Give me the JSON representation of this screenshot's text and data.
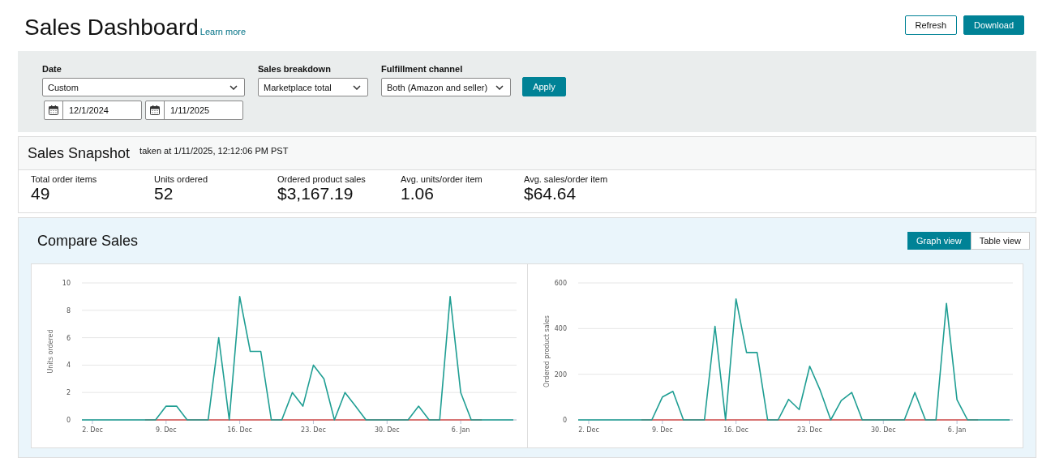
{
  "header": {
    "title": "Sales Dashboard",
    "link": "Learn more",
    "buttons": [
      {
        "label": "Refresh",
        "kind": "secondary"
      },
      {
        "label": "Download",
        "kind": "primary"
      }
    ]
  },
  "filters": {
    "date": {
      "label": "Date",
      "value": "Custom",
      "start": "12/1/2024",
      "end": "1/11/2025"
    },
    "selects": [
      {
        "label": "Sales breakdown",
        "value": "Marketplace total"
      },
      {
        "label": "Fulfillment channel",
        "value": "Both (Amazon and seller)"
      }
    ],
    "apply": "Apply"
  },
  "snapshot": {
    "title": "Sales Snapshot",
    "taken": "taken at 1/11/2025, 12:12:06 PM PST",
    "metrics": [
      {
        "label": "Total order items",
        "value": "49"
      },
      {
        "label": "Units ordered",
        "value": "52"
      },
      {
        "label": "Ordered product sales",
        "value": "$3,167.19"
      },
      {
        "label": "Avg. units/order item",
        "value": "1.06"
      },
      {
        "label": "Avg. sales/order item",
        "value": "$64.64"
      }
    ]
  },
  "compare": {
    "title": "Compare Sales",
    "views": [
      {
        "label": "Graph view",
        "selected": true
      },
      {
        "label": "Table view",
        "selected": false
      }
    ],
    "charts": [
      {
        "chart_data": {
          "type": "line",
          "ylabel": "Units ordered",
          "categories": [
            null,
            "2. Dec",
            null,
            null,
            null,
            null,
            null,
            null,
            "9. Dec",
            null,
            null,
            null,
            null,
            null,
            null,
            "16. Dec",
            null,
            null,
            null,
            null,
            null,
            null,
            "23. Dec",
            null,
            null,
            null,
            null,
            null,
            null,
            "30. Dec",
            null,
            null,
            null,
            null,
            null,
            null,
            "6. Jan",
            null,
            null,
            null,
            null,
            null
          ],
          "series": [
            {
              "color": "#1f9e93",
              "values": [
                0,
                0,
                0,
                0,
                0,
                0,
                0,
                0,
                1,
                1,
                0,
                0,
                0,
                6,
                0,
                9,
                5,
                5,
                0,
                0,
                2,
                1,
                4,
                3,
                0,
                2,
                1,
                0,
                0,
                0,
                0,
                0,
                1,
                0,
                0,
                9,
                2,
                0,
                0,
                0,
                0,
                0
              ]
            },
            {
              "color": "#d9534f",
              "values": [
                null,
                null,
                null,
                null,
                null,
                null,
                0,
                0,
                0,
                0,
                0,
                0,
                0,
                0,
                0,
                0,
                0,
                0,
                0,
                0,
                0,
                0,
                0,
                0,
                0,
                0,
                0,
                0,
                0,
                0,
                0,
                0,
                0,
                0,
                0,
                0,
                0,
                0,
                0,
                null,
                null,
                null
              ]
            }
          ],
          "ylim": [
            0,
            10
          ],
          "yticks": [
            0,
            2,
            4,
            6,
            8,
            10
          ],
          "grid": true
        }
      },
      {
        "chart_data": {
          "type": "line",
          "ylabel": "Ordered product sales",
          "categories": [
            null,
            "2. Dec",
            null,
            null,
            null,
            null,
            null,
            null,
            "9. Dec",
            null,
            null,
            null,
            null,
            null,
            null,
            "16. Dec",
            null,
            null,
            null,
            null,
            null,
            null,
            "23. Dec",
            null,
            null,
            null,
            null,
            null,
            null,
            "30. Dec",
            null,
            null,
            null,
            null,
            null,
            null,
            "6. Jan",
            null,
            null,
            null,
            null,
            null
          ],
          "series": [
            {
              "color": "#1f9e93",
              "values": [
                0,
                0,
                0,
                0,
                0,
                0,
                0,
                0,
                100,
                125,
                0,
                0,
                0,
                410,
                0,
                530,
                295,
                295,
                0,
                0,
                90,
                45,
                235,
                130,
                0,
                85,
                120,
                0,
                0,
                0,
                0,
                0,
                120,
                0,
                0,
                510,
                88,
                0,
                0,
                0,
                0,
                0
              ]
            },
            {
              "color": "#d9534f",
              "values": [
                null,
                null,
                null,
                null,
                null,
                null,
                0,
                0,
                0,
                0,
                0,
                0,
                0,
                0,
                0,
                0,
                0,
                0,
                0,
                0,
                0,
                0,
                0,
                0,
                0,
                0,
                0,
                0,
                0,
                0,
                0,
                0,
                0,
                0,
                0,
                0,
                0,
                0,
                0,
                null,
                null,
                null
              ]
            }
          ],
          "ylim": [
            0,
            600
          ],
          "yticks": [
            0,
            200,
            400,
            600
          ],
          "grid": true
        }
      }
    ]
  }
}
